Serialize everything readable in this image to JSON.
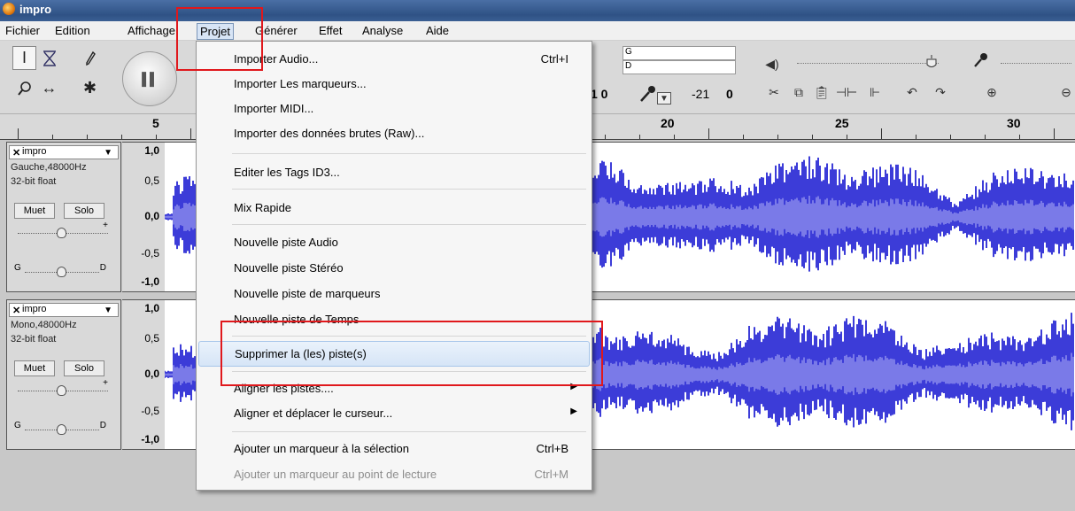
{
  "window": {
    "title": "impro"
  },
  "menubar": {
    "items": [
      "Fichier",
      "Edition",
      "Affichage",
      "Projet",
      "Générer",
      "Effet",
      "Analyse",
      "Aide"
    ],
    "active": "Projet"
  },
  "toolbar": {
    "meter_left": "G",
    "meter_right": "D",
    "input_level_text": "1  0",
    "input_db_a": "-21",
    "input_db_b": "0"
  },
  "ruler": {
    "labels": [
      "5",
      "20",
      "25",
      "30"
    ]
  },
  "tracks": [
    {
      "name": "impro",
      "info1": "Gauche,48000Hz",
      "info2": "32-bit float",
      "mute": "Muet",
      "solo": "Solo",
      "gain_sign": "+",
      "pan_left": "G",
      "pan_right": "D",
      "scale": [
        "1,0",
        "0,5",
        "0,0",
        "-0,5",
        "-1,0"
      ]
    },
    {
      "name": "impro",
      "info1": "Mono,48000Hz",
      "info2": "32-bit float",
      "mute": "Muet",
      "solo": "Solo",
      "gain_sign": "+",
      "pan_left": "G",
      "pan_right": "D",
      "scale": [
        "1,0",
        "0,5",
        "0,0",
        "-0,5",
        "-1,0"
      ]
    }
  ],
  "projet_menu": {
    "items": [
      {
        "label": "Importer Audio...",
        "shortcut": "Ctrl+I"
      },
      {
        "label": "Importer Les marqueurs...",
        "shortcut": ""
      },
      {
        "label": "Importer MIDI...",
        "shortcut": ""
      },
      {
        "label": "Importer des données brutes (Raw)...",
        "shortcut": ""
      },
      {
        "label": "Editer les Tags ID3...",
        "shortcut": ""
      },
      {
        "label": "Mix Rapide",
        "shortcut": ""
      },
      {
        "label": "Nouvelle piste Audio",
        "shortcut": ""
      },
      {
        "label": "Nouvelle piste Stéréo",
        "shortcut": ""
      },
      {
        "label": "Nouvelle piste de marqueurs",
        "shortcut": ""
      },
      {
        "label": "Nouvelle piste de Temps",
        "shortcut": ""
      },
      {
        "label": "Supprimer la (les) piste(s)",
        "shortcut": ""
      },
      {
        "label": "Aligner les pistes....",
        "shortcut": ""
      },
      {
        "label": "Aligner et déplacer le curseur...",
        "shortcut": ""
      },
      {
        "label": "Ajouter un marqueur à  la sélection",
        "shortcut": "Ctrl+B"
      },
      {
        "label": "Ajouter un marqueur au point de lecture",
        "shortcut": "Ctrl+M"
      }
    ]
  },
  "colors": {
    "waveform": "#3c3cd8",
    "waveform_rms": "#7a7ae8",
    "highlight_box": "#e0181c",
    "menu_highlight": "#d6e5f7"
  },
  "icons": [
    "app-icon",
    "ibeam-tool-icon",
    "envelope-tool-icon",
    "draw-tool-icon",
    "zoom-tool-icon",
    "timeshift-tool-icon",
    "multi-tool-icon",
    "pause-icon",
    "speaker-icon",
    "microphone-icon",
    "cut-icon",
    "copy-icon",
    "paste-icon",
    "trim-icon",
    "silence-icon",
    "undo-icon",
    "redo-icon",
    "zoom-in-icon",
    "submenu-arrow-icon",
    "close-track-icon"
  ]
}
